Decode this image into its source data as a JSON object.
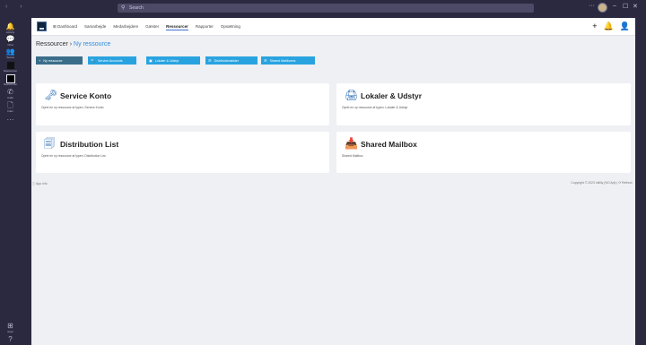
{
  "titlebar": {
    "search_placeholder": "Search",
    "more": "···",
    "window_controls": [
      "–",
      "☐",
      "✕"
    ]
  },
  "rail": {
    "items": [
      {
        "label": "Activity",
        "icon": "bell-icon",
        "glyph": "🔔"
      },
      {
        "label": "Chat",
        "icon": "chat-icon",
        "glyph": "💬"
      },
      {
        "label": "Teams",
        "icon": "teams-icon",
        "glyph": "👥"
      },
      {
        "label": "Ressourcer",
        "icon": "app-square-icon",
        "glyph": ""
      },
      {
        "label": "Ressourcer",
        "icon": "app-square-icon",
        "glyph": ""
      },
      {
        "label": "Calls",
        "icon": "phone-icon",
        "glyph": "✆"
      },
      {
        "label": "Files",
        "icon": "file-icon",
        "glyph": "🗋"
      },
      {
        "label": "",
        "icon": "more-icon",
        "glyph": "···"
      }
    ],
    "bottom": [
      {
        "label": "Apps",
        "icon": "apps-icon",
        "glyph": "⊞"
      },
      {
        "label": "Help",
        "icon": "help-icon",
        "glyph": "?"
      }
    ]
  },
  "app": {
    "nav": [
      "Dashboard",
      "Samarbejde",
      "Medarbejdere",
      "Gæster",
      "Ressourcer",
      "Rapporter",
      "Opsætning"
    ],
    "active_nav": "Ressourcer",
    "header_icons": [
      "+",
      "🔔",
      "👤"
    ],
    "breadcrumb": {
      "parent": "Ressourcer",
      "separator": "›",
      "current": "Ny ressource"
    },
    "buttons": [
      {
        "label": "Ny ressource",
        "glyph": "+",
        "style": "dark"
      },
      {
        "label": "Service Accounts",
        "glyph": "🔍",
        "style": "blue"
      },
      {
        "label": "Lokaler & Udstyr",
        "glyph": "▣",
        "style": "blue"
      },
      {
        "label": "Distributionslister",
        "glyph": "☰",
        "style": "blue"
      },
      {
        "label": "Shared Mailboxes",
        "glyph": "☰",
        "style": "blue"
      }
    ],
    "cards": [
      {
        "title": "Service Konto",
        "desc": "Opret en ny ressource af typen: Service Konto",
        "icon": "key-icon",
        "glyph": "🗝"
      },
      {
        "title": "Lokaler & Udstyr",
        "desc": "Opret en ny ressource af typen: Lokaler & Udstyr",
        "icon": "printer-icon",
        "glyph": "🖨"
      },
      {
        "title": "Distribution List",
        "desc": "Opret en ny ressource af typen: Distribution List",
        "icon": "distribution-list-icon",
        "glyph": "🗐"
      },
      {
        "title": "Shared Mailbox",
        "desc": "Shared Mailbox",
        "icon": "mailbox-icon",
        "glyph": "📥"
      }
    ],
    "footer_left": "ⓘ App info",
    "footer_right": "Copyright © 2023 Intility (NO Apt) | ⟳ Refresh"
  }
}
